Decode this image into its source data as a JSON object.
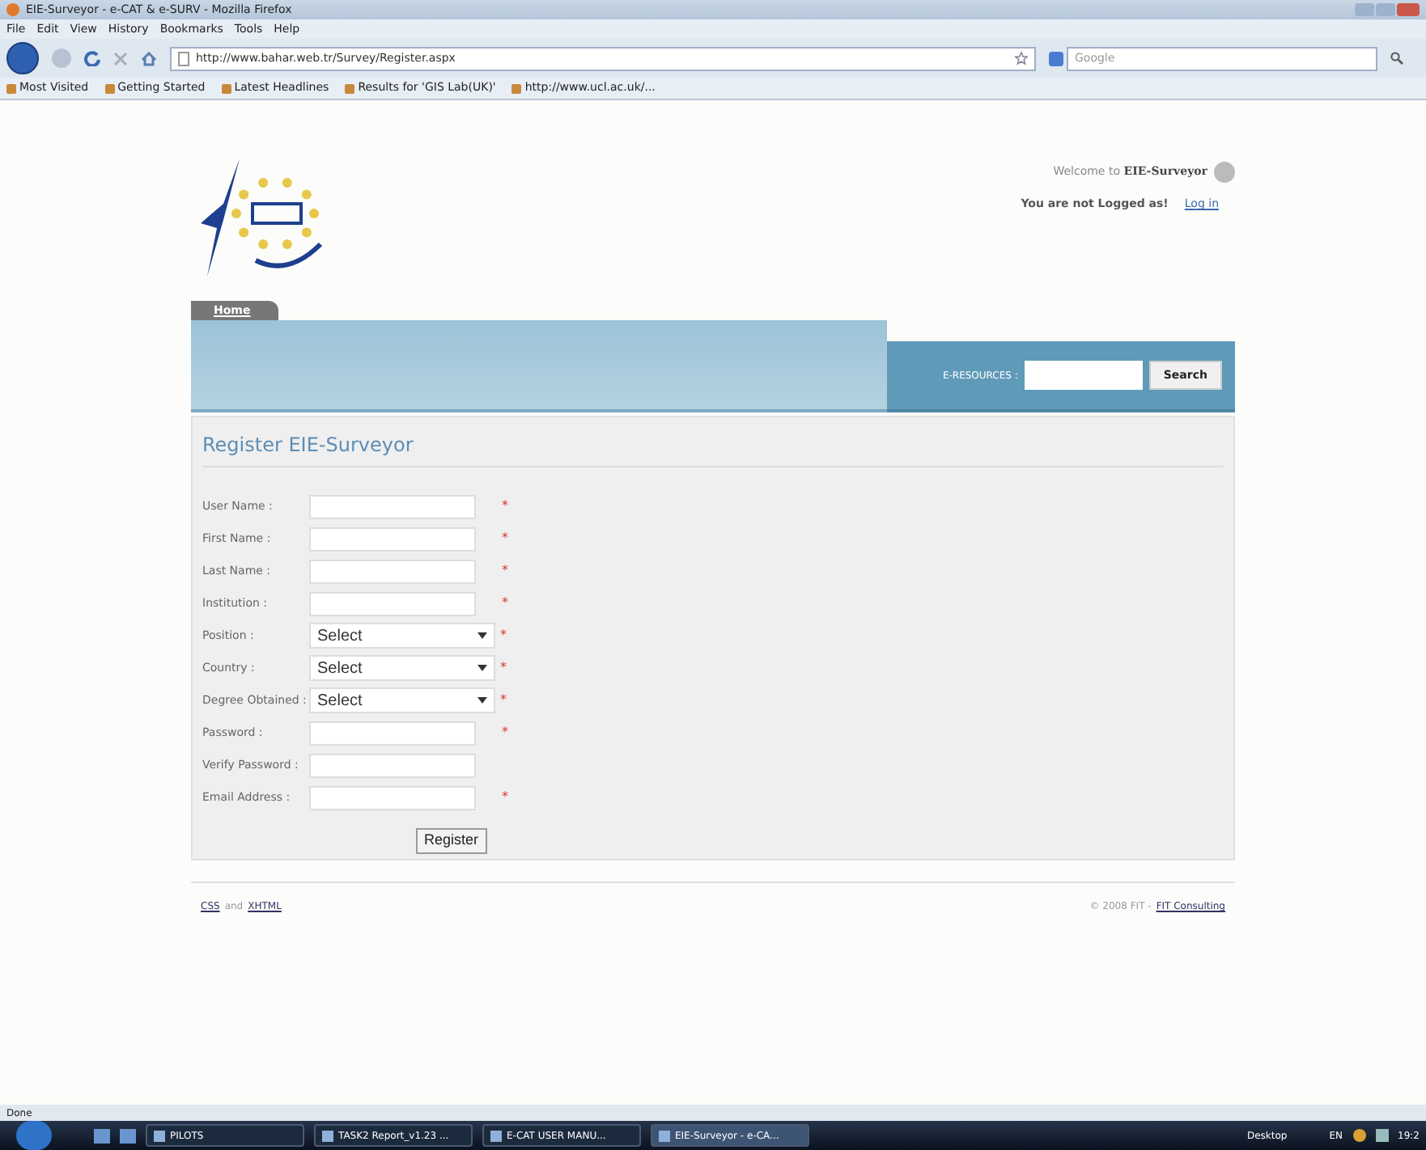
{
  "window": {
    "title": "EIE-Surveyor - e-CAT & e-SURV - Mozilla Firefox"
  },
  "menu": [
    "File",
    "Edit",
    "View",
    "History",
    "Bookmarks",
    "Tools",
    "Help"
  ],
  "address": {
    "value": "http://www.bahar.web.tr/Survey/Register.aspx"
  },
  "search_engine": {
    "placeholder": "Google"
  },
  "bookmarks": [
    "Most Visited",
    "Getting Started",
    "Latest Headlines",
    "Results for 'GIS Lab(UK)'",
    "http://www.ucl.ac.uk/..."
  ],
  "header": {
    "welcome": "Welcome to",
    "site": "EIE-Surveyor",
    "login_status": "You are not Logged as!",
    "login_link": "Log in"
  },
  "nav_tabs": [
    {
      "label": "Home",
      "selected": true
    }
  ],
  "resources": {
    "label": "E-RESOURCES :",
    "button": "Search"
  },
  "form": {
    "title": "Register EIE-Surveyor",
    "fields": [
      {
        "label": "User Name :",
        "kind": "text",
        "required": true
      },
      {
        "label": "First Name :",
        "kind": "text",
        "required": true
      },
      {
        "label": "Last Name :",
        "kind": "text",
        "required": true
      },
      {
        "label": "Institution :",
        "kind": "text",
        "required": true
      },
      {
        "label": "Position :",
        "kind": "select",
        "value": "Select",
        "required": true
      },
      {
        "label": "Country :",
        "kind": "select",
        "value": "Select",
        "required": true
      },
      {
        "label": "Degree Obtained :",
        "kind": "select",
        "value": "Select",
        "required": true
      },
      {
        "label": "Password :",
        "kind": "text",
        "required": true
      },
      {
        "label": "Verify Password :",
        "kind": "text",
        "required": false
      },
      {
        "label": "Email Address :",
        "kind": "text",
        "required": true
      }
    ],
    "required_mark": "*",
    "submit": "Register"
  },
  "footer": {
    "left": [
      {
        "text": "CSS",
        "link": true
      },
      {
        "text": "and",
        "link": false
      },
      {
        "text": "XHTML",
        "link": true
      }
    ],
    "right": [
      {
        "text": "© 2008 FIT -",
        "link": false
      },
      {
        "text": "FIT Consulting",
        "link": true
      }
    ]
  },
  "status_bar": "Done",
  "taskbar": {
    "items": [
      {
        "label": "PILOTS",
        "selected": false
      },
      {
        "label": "TASK2 Report_v1.23 ...",
        "selected": false
      },
      {
        "label": "E-CAT USER MANU...",
        "selected": false
      },
      {
        "label": "EIE-Surveyor - e-CA...",
        "selected": true
      }
    ],
    "desktop": "Desktop",
    "language": "EN",
    "clock": "19:2"
  }
}
